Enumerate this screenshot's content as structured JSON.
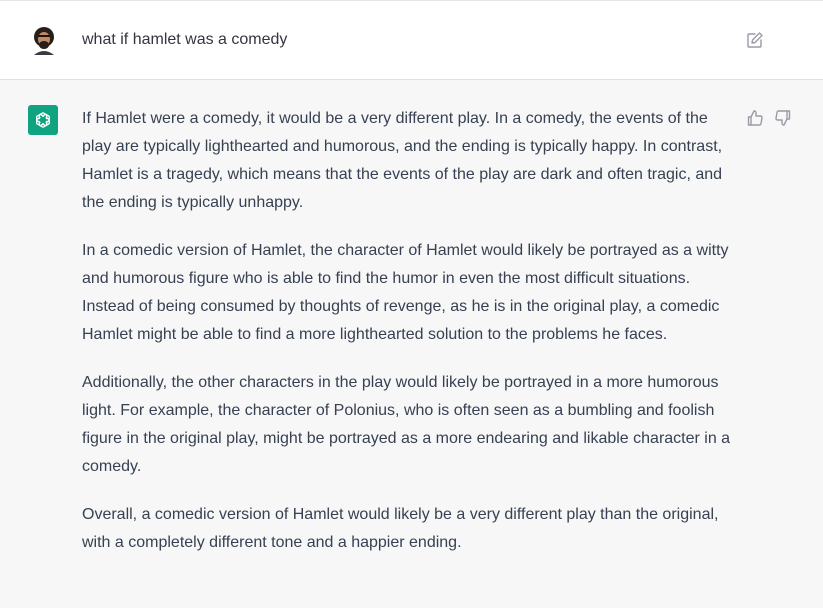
{
  "user_message": {
    "text": "what if hamlet was a comedy"
  },
  "assistant_message": {
    "paragraphs": [
      "If Hamlet were a comedy, it would be a very different play. In a comedy, the events of the play are typically lighthearted and humorous, and the ending is typically happy. In contrast, Hamlet is a tragedy, which means that the events of the play are dark and often tragic, and the ending is typically unhappy.",
      "In a comedic version of Hamlet, the character of Hamlet would likely be portrayed as a witty and humorous figure who is able to find the humor in even the most difficult situations. Instead of being consumed by thoughts of revenge, as he is in the original play, a comedic Hamlet might be able to find a more lighthearted solution to the problems he faces.",
      "Additionally, the other characters in the play would likely be portrayed in a more humorous light. For example, the character of Polonius, who is often seen as a bumbling and foolish figure in the original play, might be portrayed as a more endearing and likable character in a comedy.",
      "Overall, a comedic version of Hamlet would likely be a very different play than the original, with a completely different tone and a happier ending."
    ]
  },
  "icons": {
    "edit": "edit-icon",
    "thumbs_up": "thumbs-up-icon",
    "thumbs_down": "thumbs-down-icon",
    "assistant_logo": "openai-logo-icon"
  },
  "colors": {
    "assistant_avatar_bg": "#10a37f",
    "user_bg": "#ffffff",
    "assistant_bg": "#f7f7f8"
  }
}
